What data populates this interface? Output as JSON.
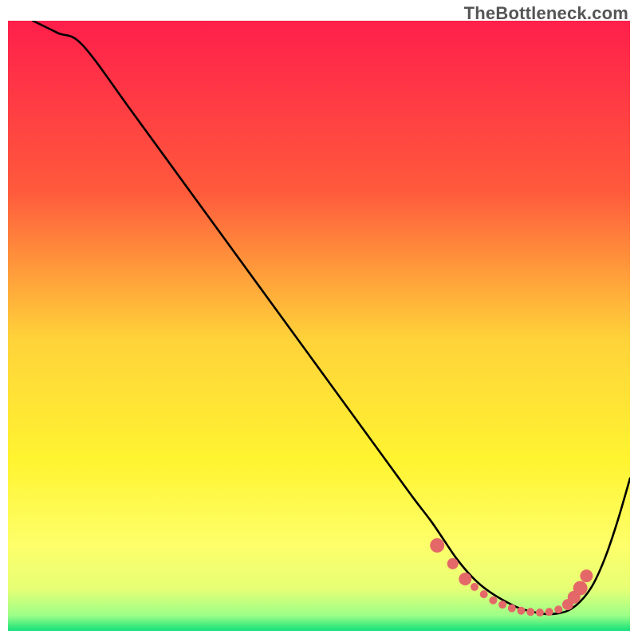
{
  "watermark": "TheBottleneck.com",
  "chart_data": {
    "type": "line",
    "title": "",
    "xlabel": "",
    "ylabel": "",
    "xlim": [
      0,
      100
    ],
    "ylim": [
      0,
      100
    ],
    "grid": false,
    "legend": false,
    "gradient_stops": [
      {
        "offset": 0,
        "color": "#ff1f4b"
      },
      {
        "offset": 0.28,
        "color": "#ff5a3c"
      },
      {
        "offset": 0.52,
        "color": "#ffd23a"
      },
      {
        "offset": 0.72,
        "color": "#fff430"
      },
      {
        "offset": 0.86,
        "color": "#feff6a"
      },
      {
        "offset": 0.93,
        "color": "#e7ff75"
      },
      {
        "offset": 0.975,
        "color": "#9cff88"
      },
      {
        "offset": 1.0,
        "color": "#14e07a"
      }
    ],
    "series": [
      {
        "name": "bottleneck-curve",
        "stroke": "#000000",
        "stroke_width": 2.6,
        "x": [
          4,
          8,
          12,
          20,
          30,
          40,
          50,
          60,
          65,
          68,
          70,
          72,
          74,
          76,
          78,
          80,
          82,
          84,
          86,
          88,
          90,
          92,
          94,
          96,
          98,
          100
        ],
        "y": [
          100,
          98,
          96,
          85,
          71,
          57,
          43,
          29,
          22,
          18,
          15,
          12,
          9.5,
          7.5,
          6,
          4.8,
          3.8,
          3.2,
          2.8,
          2.8,
          3.3,
          4.8,
          7.5,
          12,
          18,
          25
        ]
      }
    ],
    "markers": {
      "name": "optimal-zone-dots",
      "color": "#e46868",
      "radius_small": 5,
      "radius_large": 9,
      "points": [
        {
          "x": 69,
          "y": 14,
          "r": 9
        },
        {
          "x": 71.5,
          "y": 11,
          "r": 7
        },
        {
          "x": 73.5,
          "y": 8.5,
          "r": 8
        },
        {
          "x": 75,
          "y": 7.2,
          "r": 5
        },
        {
          "x": 76.5,
          "y": 6,
          "r": 5
        },
        {
          "x": 78,
          "y": 5,
          "r": 5
        },
        {
          "x": 79.5,
          "y": 4.3,
          "r": 5
        },
        {
          "x": 81,
          "y": 3.7,
          "r": 5
        },
        {
          "x": 82.5,
          "y": 3.3,
          "r": 5
        },
        {
          "x": 84,
          "y": 3.1,
          "r": 5
        },
        {
          "x": 85.5,
          "y": 3,
          "r": 5
        },
        {
          "x": 87,
          "y": 3.1,
          "r": 5
        },
        {
          "x": 88.5,
          "y": 3.5,
          "r": 5
        },
        {
          "x": 90,
          "y": 4.3,
          "r": 7
        },
        {
          "x": 91,
          "y": 5.5,
          "r": 8
        },
        {
          "x": 92,
          "y": 7,
          "r": 9
        },
        {
          "x": 93,
          "y": 9,
          "r": 8
        }
      ]
    }
  }
}
